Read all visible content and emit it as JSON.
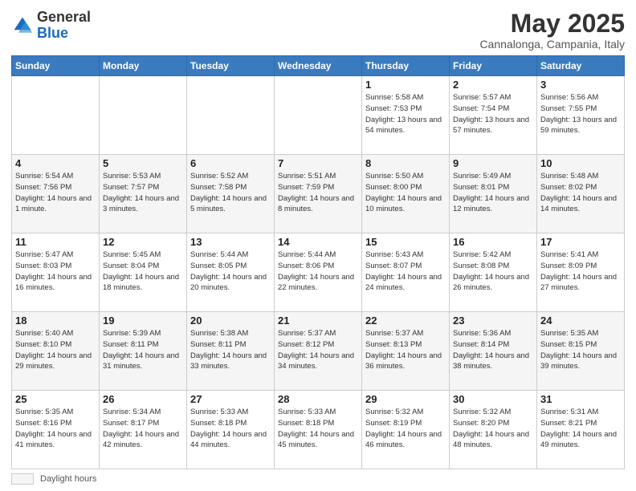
{
  "header": {
    "logo_general": "General",
    "logo_blue": "Blue",
    "main_title": "May 2025",
    "subtitle": "Cannalonga, Campania, Italy"
  },
  "calendar": {
    "days_of_week": [
      "Sunday",
      "Monday",
      "Tuesday",
      "Wednesday",
      "Thursday",
      "Friday",
      "Saturday"
    ],
    "weeks": [
      [
        {
          "day": "",
          "info": ""
        },
        {
          "day": "",
          "info": ""
        },
        {
          "day": "",
          "info": ""
        },
        {
          "day": "",
          "info": ""
        },
        {
          "day": "1",
          "info": "Sunrise: 5:58 AM\nSunset: 7:53 PM\nDaylight: 13 hours\nand 54 minutes."
        },
        {
          "day": "2",
          "info": "Sunrise: 5:57 AM\nSunset: 7:54 PM\nDaylight: 13 hours\nand 57 minutes."
        },
        {
          "day": "3",
          "info": "Sunrise: 5:56 AM\nSunset: 7:55 PM\nDaylight: 13 hours\nand 59 minutes."
        }
      ],
      [
        {
          "day": "4",
          "info": "Sunrise: 5:54 AM\nSunset: 7:56 PM\nDaylight: 14 hours\nand 1 minute."
        },
        {
          "day": "5",
          "info": "Sunrise: 5:53 AM\nSunset: 7:57 PM\nDaylight: 14 hours\nand 3 minutes."
        },
        {
          "day": "6",
          "info": "Sunrise: 5:52 AM\nSunset: 7:58 PM\nDaylight: 14 hours\nand 5 minutes."
        },
        {
          "day": "7",
          "info": "Sunrise: 5:51 AM\nSunset: 7:59 PM\nDaylight: 14 hours\nand 8 minutes."
        },
        {
          "day": "8",
          "info": "Sunrise: 5:50 AM\nSunset: 8:00 PM\nDaylight: 14 hours\nand 10 minutes."
        },
        {
          "day": "9",
          "info": "Sunrise: 5:49 AM\nSunset: 8:01 PM\nDaylight: 14 hours\nand 12 minutes."
        },
        {
          "day": "10",
          "info": "Sunrise: 5:48 AM\nSunset: 8:02 PM\nDaylight: 14 hours\nand 14 minutes."
        }
      ],
      [
        {
          "day": "11",
          "info": "Sunrise: 5:47 AM\nSunset: 8:03 PM\nDaylight: 14 hours\nand 16 minutes."
        },
        {
          "day": "12",
          "info": "Sunrise: 5:45 AM\nSunset: 8:04 PM\nDaylight: 14 hours\nand 18 minutes."
        },
        {
          "day": "13",
          "info": "Sunrise: 5:44 AM\nSunset: 8:05 PM\nDaylight: 14 hours\nand 20 minutes."
        },
        {
          "day": "14",
          "info": "Sunrise: 5:44 AM\nSunset: 8:06 PM\nDaylight: 14 hours\nand 22 minutes."
        },
        {
          "day": "15",
          "info": "Sunrise: 5:43 AM\nSunset: 8:07 PM\nDaylight: 14 hours\nand 24 minutes."
        },
        {
          "day": "16",
          "info": "Sunrise: 5:42 AM\nSunset: 8:08 PM\nDaylight: 14 hours\nand 26 minutes."
        },
        {
          "day": "17",
          "info": "Sunrise: 5:41 AM\nSunset: 8:09 PM\nDaylight: 14 hours\nand 27 minutes."
        }
      ],
      [
        {
          "day": "18",
          "info": "Sunrise: 5:40 AM\nSunset: 8:10 PM\nDaylight: 14 hours\nand 29 minutes."
        },
        {
          "day": "19",
          "info": "Sunrise: 5:39 AM\nSunset: 8:11 PM\nDaylight: 14 hours\nand 31 minutes."
        },
        {
          "day": "20",
          "info": "Sunrise: 5:38 AM\nSunset: 8:11 PM\nDaylight: 14 hours\nand 33 minutes."
        },
        {
          "day": "21",
          "info": "Sunrise: 5:37 AM\nSunset: 8:12 PM\nDaylight: 14 hours\nand 34 minutes."
        },
        {
          "day": "22",
          "info": "Sunrise: 5:37 AM\nSunset: 8:13 PM\nDaylight: 14 hours\nand 36 minutes."
        },
        {
          "day": "23",
          "info": "Sunrise: 5:36 AM\nSunset: 8:14 PM\nDaylight: 14 hours\nand 38 minutes."
        },
        {
          "day": "24",
          "info": "Sunrise: 5:35 AM\nSunset: 8:15 PM\nDaylight: 14 hours\nand 39 minutes."
        }
      ],
      [
        {
          "day": "25",
          "info": "Sunrise: 5:35 AM\nSunset: 8:16 PM\nDaylight: 14 hours\nand 41 minutes."
        },
        {
          "day": "26",
          "info": "Sunrise: 5:34 AM\nSunset: 8:17 PM\nDaylight: 14 hours\nand 42 minutes."
        },
        {
          "day": "27",
          "info": "Sunrise: 5:33 AM\nSunset: 8:18 PM\nDaylight: 14 hours\nand 44 minutes."
        },
        {
          "day": "28",
          "info": "Sunrise: 5:33 AM\nSunset: 8:18 PM\nDaylight: 14 hours\nand 45 minutes."
        },
        {
          "day": "29",
          "info": "Sunrise: 5:32 AM\nSunset: 8:19 PM\nDaylight: 14 hours\nand 46 minutes."
        },
        {
          "day": "30",
          "info": "Sunrise: 5:32 AM\nSunset: 8:20 PM\nDaylight: 14 hours\nand 48 minutes."
        },
        {
          "day": "31",
          "info": "Sunrise: 5:31 AM\nSunset: 8:21 PM\nDaylight: 14 hours\nand 49 minutes."
        }
      ]
    ]
  },
  "footer": {
    "swatch_label": "Daylight hours"
  }
}
